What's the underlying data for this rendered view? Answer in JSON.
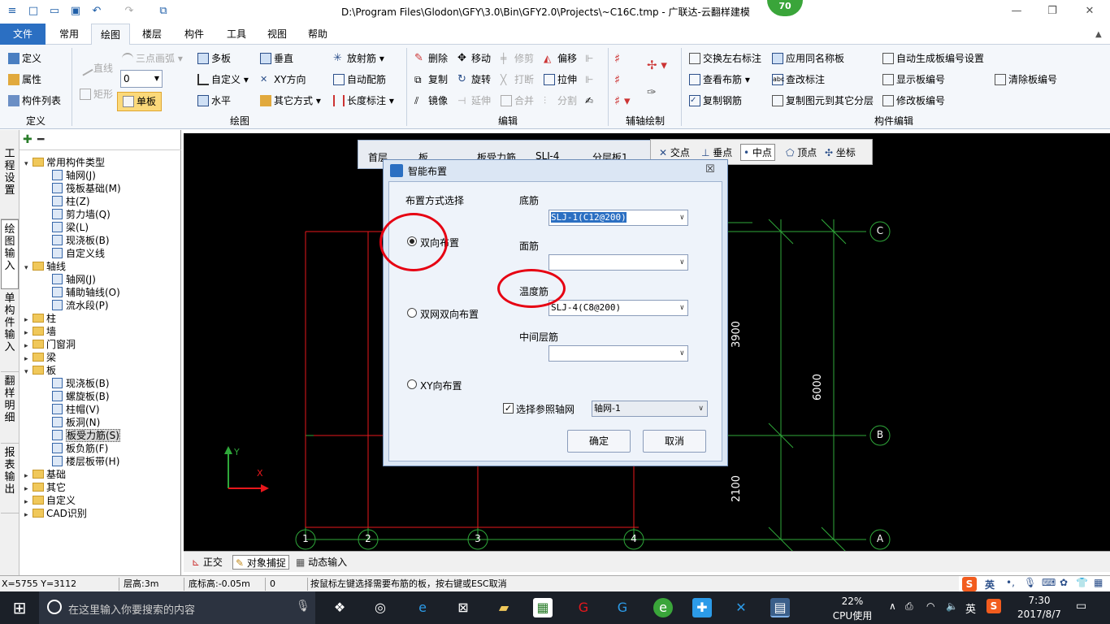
{
  "window": {
    "title": "D:\\Program Files\\Glodon\\GFY\\3.0\\Bin\\GFY2.0\\Projects\\~C16C.tmp - 广联达-云翻样建模",
    "badge": "70",
    "minimize": "—",
    "restore": "❐",
    "close": "✕"
  },
  "menu": {
    "file": "文件",
    "tabs": [
      "常用",
      "绘图",
      "楼层",
      "构件",
      "工具",
      "视图",
      "帮助"
    ]
  },
  "ribbon": {
    "define": {
      "items": [
        "定义",
        "属性",
        "构件列表"
      ],
      "label": "定义"
    },
    "draw": {
      "line": "直线",
      "arc": "三点画弧",
      "rect": "矩形",
      "single": "单板",
      "multi": "多板",
      "custom": "自定义",
      "horizontal": "水平",
      "vertical": "垂直",
      "xy": "XY方向",
      "other": "其它方式",
      "radial": "放射筋",
      "auto": "自动配筋",
      "length": "长度标注",
      "input_value": "0",
      "label": "绘图"
    },
    "edit": {
      "items": [
        "删除",
        "移动",
        "修剪",
        "偏移",
        "复制",
        "旋转",
        "打断",
        "拉伸",
        "镜像",
        "延伸",
        "合并",
        "分割"
      ],
      "label": "编辑"
    },
    "axis": {
      "label": "辅轴绘制"
    },
    "compedit": {
      "items": [
        "交换左右标注",
        "应用同名称板",
        "自动生成板编号设置",
        "查看布筋",
        "查改标注",
        "显示板编号",
        "清除板编号",
        "复制钢筋",
        "复制图元到其它分层",
        "修改板编号"
      ],
      "label": "构件编辑"
    }
  },
  "leftbar": {
    "tabs": [
      "工程设置",
      "绘图输入",
      "单构件输入",
      "翻样明细",
      "报表输出"
    ]
  },
  "tree": {
    "groups": [
      {
        "label": "常用构件类型",
        "children": [
          "轴网(J)",
          "筏板基础(M)",
          "柱(Z)",
          "剪力墙(Q)",
          "梁(L)",
          "现浇板(B)",
          "自定义线"
        ]
      },
      {
        "label": "轴线",
        "children": [
          "轴网(J)",
          "辅助轴线(O)",
          "流水段(P)"
        ]
      },
      {
        "label": "柱"
      },
      {
        "label": "墙"
      },
      {
        "label": "门窗洞"
      },
      {
        "label": "梁"
      },
      {
        "label": "板",
        "children": [
          "现浇板(B)",
          "螺旋板(B)",
          "柱帽(V)",
          "板洞(N)",
          "板受力筋(S)",
          "板负筋(F)",
          "楼层板带(H)"
        ]
      },
      {
        "label": "基础"
      },
      {
        "label": "其它"
      },
      {
        "label": "自定义"
      },
      {
        "label": "CAD识别"
      }
    ]
  },
  "canvas": {
    "floor_selectors": [
      "首层",
      "板",
      "板受力筋",
      "SLJ-4",
      "分层板1"
    ],
    "snap": [
      "交点",
      "垂点",
      "中点",
      "顶点",
      "坐标"
    ],
    "axis_numbers": [
      "1",
      "2",
      "3",
      "4"
    ],
    "axis_letters": [
      "C",
      "B",
      "A"
    ],
    "dims": [
      "3900",
      "6000",
      "2100"
    ],
    "ucs_y": "Y",
    "ucs_x": "X",
    "colors": {
      "background": "#000000",
      "red_lines": "#e8171c",
      "green_lines": "#2fa83a",
      "white_text": "#ffffff"
    }
  },
  "canvas_toolbar": {
    "ortho": "正交",
    "snap": "对象捕捉",
    "dynamic": "动态输入"
  },
  "dialog": {
    "title": "智能布置",
    "mode_title": "布置方式选择",
    "modes": [
      "双向布置",
      "双网双向布置",
      "XY向布置"
    ],
    "selected_mode": "双向布置",
    "bottom_label": "底筋",
    "bottom_value": "SLJ-1(C12@200)",
    "top_label": "面筋",
    "top_value": "",
    "temp_label": "温度筋",
    "temp_value": "SLJ-4(C8@200)",
    "mid_label": "中间层筋",
    "mid_value": "",
    "ref_grid_label": "选择参照轴网",
    "ref_grid_checked": true,
    "ref_grid_value": "轴网-1",
    "ok": "确定",
    "cancel": "取消"
  },
  "status": {
    "coords": "X=5755 Y=3112",
    "floor_height": "层高:3m",
    "bottom_elev": "底标高:-0.05m",
    "value": "0",
    "hint": "按鼠标左键选择需要布筋的板，按右键或ESC取消"
  },
  "taskbar": {
    "search_placeholder": "在这里输入你要搜索的内容",
    "cpu_percent": "22%",
    "cpu_label": "CPU使用",
    "ime": "英",
    "time": "7:30",
    "date": "2017/8/7",
    "sogou_ime": "英"
  }
}
